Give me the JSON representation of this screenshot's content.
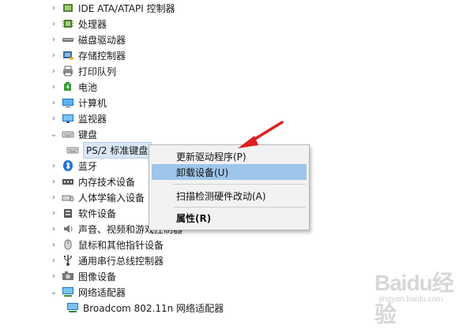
{
  "tree": [
    {
      "label": "IDE ATA/ATAPI 控制器",
      "icon": "ide-controller-icon"
    },
    {
      "label": "处理器",
      "icon": "processor-icon"
    },
    {
      "label": "磁盘驱动器",
      "icon": "disk-drive-icon"
    },
    {
      "label": "存储控制器",
      "icon": "storage-controller-icon"
    },
    {
      "label": "打印队列",
      "icon": "printer-icon"
    },
    {
      "label": "电池",
      "icon": "battery-icon"
    },
    {
      "label": "计算机",
      "icon": "computer-icon"
    },
    {
      "label": "监视器",
      "icon": "monitor-icon"
    },
    {
      "label": "键盘",
      "icon": "keyboard-icon",
      "expanded": true
    },
    {
      "label": "PS/2 标准键盘",
      "icon": "keyboard-icon",
      "child": true,
      "selected": true
    },
    {
      "label": "蓝牙",
      "icon": "bluetooth-icon"
    },
    {
      "label": "内存技术设备",
      "icon": "memory-icon"
    },
    {
      "label": "人体学输入设备",
      "icon": "hid-icon"
    },
    {
      "label": "软件设备",
      "icon": "software-device-icon"
    },
    {
      "label": "声音、视频和游戏控制器",
      "icon": "speaker-icon"
    },
    {
      "label": "鼠标和其他指针设备",
      "icon": "mouse-icon"
    },
    {
      "label": "通用串行总线控制器",
      "icon": "usb-icon"
    },
    {
      "label": "图像设备",
      "icon": "camera-icon"
    },
    {
      "label": "网络适配器",
      "icon": "network-adapter-icon",
      "expanded": true
    },
    {
      "label": "Broadcom 802.11n 网络适配器",
      "icon": "network-adapter-icon",
      "child": true
    }
  ],
  "context_menu": {
    "update_driver": "更新驱动程序(P)",
    "uninstall_device": "卸载设备(U)",
    "scan_hardware": "扫描检测硬件改动(A)",
    "properties": "属性(R)"
  },
  "watermark": {
    "brand": "Baidu经验",
    "url": "jingyan.baidu.com"
  },
  "colors": {
    "menu_highlight": "#9ec5ea",
    "selection": "#d9e6f5",
    "arrow": "#e02020"
  }
}
